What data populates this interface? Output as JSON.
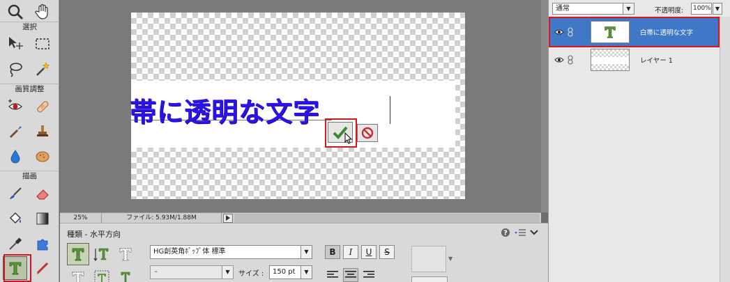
{
  "toolbox": {
    "sections": {
      "select": "選択",
      "enhance": "画質調整",
      "draw": "描画"
    }
  },
  "canvas": {
    "text": "帯に透明な文字"
  },
  "status_bar": {
    "zoom": "25%",
    "file_info": "ファイル: 5.93M/1.88M"
  },
  "options": {
    "title": "種類 - 水平方向",
    "font_family": "HG創英角ﾎﾟｯﾌﾟ体 標準",
    "font_style": "-",
    "size_label": "サイズ :",
    "size_value": "150 pt",
    "bold": "B",
    "italic": "I",
    "underline": "U",
    "strike": "S"
  },
  "layers": {
    "blend_mode": "通常",
    "opacity_label": "不透明度:",
    "opacity_value": "100%",
    "items": [
      {
        "name": "白帯に透明な文字",
        "type": "text",
        "selected": true
      },
      {
        "name": "レイヤー 1",
        "type": "raster",
        "selected": false
      }
    ]
  },
  "colors": {
    "accent_selection": "#3e78c6",
    "highlight_box": "#d8141c",
    "text_color": "#2b12e8"
  }
}
